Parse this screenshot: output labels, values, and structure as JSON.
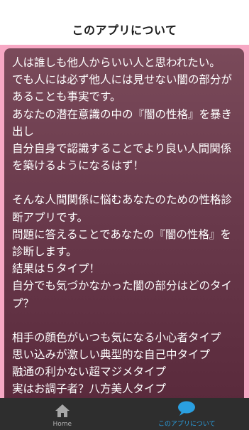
{
  "header": {
    "title": "このアプリについて"
  },
  "content": {
    "paragraphs": [
      {
        "lines": [
          "人は誰しも他人からいい人と思われたい。",
          "でも人には必ず他人には見せない闇の部分が",
          "あることも事実です。",
          "あなたの潜在意識の中の『闇の性格』を暴き",
          "出し",
          "自分自身で認識することでより良い人間関係",
          "を築けるようになるはず！"
        ]
      },
      {
        "lines": [
          "そんな人間関係に悩むあなたのための性格診",
          "断アプリです。",
          "問題に答えることであなたの『闇の性格』を",
          "診断します。",
          "結果は５タイプ！",
          "自分でも気づかなかった闇の部分はどのタイ",
          "プ？"
        ]
      },
      {
        "lines": [
          "相手の顔色がいつも気になる小心者タイプ",
          "思い込みが激しい典型的な自己中タイプ",
          "融通の利かない超マジメタイプ",
          "実はお調子者？八方美人タイプ"
        ]
      }
    ]
  },
  "tabbar": {
    "tabs": [
      {
        "label": "Home",
        "icon": "home-icon",
        "active": false
      },
      {
        "label": "このアプリについて",
        "icon": "speech-bubble-icon",
        "active": true
      }
    ],
    "colors": {
      "background": "#2e2e2e",
      "inactive": "#b0b0b0",
      "active": "#2a9fe0"
    }
  },
  "colors": {
    "accent_background": "#f7a8c4",
    "card": "#6a3a4c"
  }
}
